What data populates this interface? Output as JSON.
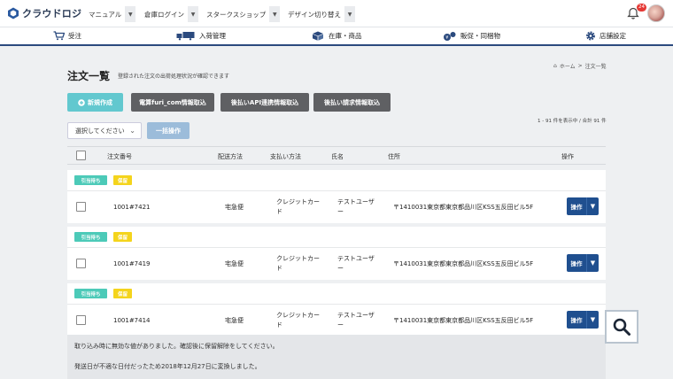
{
  "brand": {
    "name": "クラウドロジ"
  },
  "topmenu": [
    {
      "label": "マニュアル"
    },
    {
      "label": "倉庫ログイン"
    },
    {
      "label": "スタークスショップ"
    },
    {
      "label": "デザイン切り替え"
    }
  ],
  "notifications": {
    "count": "24"
  },
  "nav": [
    {
      "label": "受注",
      "icon": "cart-icon"
    },
    {
      "label": "入荷管理",
      "icon": "truck-icon"
    },
    {
      "label": "在庫・商品",
      "icon": "box-icon"
    },
    {
      "label": "販促・同梱物",
      "icon": "promo-icon"
    },
    {
      "label": "店舗設定",
      "icon": "gear-icon"
    }
  ],
  "page": {
    "title": "注文一覧",
    "subtitle": "登録された注文の出荷処理状況が確認できます",
    "breadcrumb": {
      "home": "ホーム",
      "separator": ">",
      "current": "注文一覧"
    }
  },
  "actions": {
    "new": "新規作成",
    "import1": "電算furi_com情報取込",
    "import2": "後払いAPI連携情報取込",
    "import3": "後払い請求情報取込"
  },
  "list": {
    "count_text": "1 - 91 件を表示中 / 合計 91 件",
    "select_placeholder": "選択してください",
    "bulk_label": "一括操作"
  },
  "table": {
    "headers": {
      "order_no": "注文番号",
      "shipping": "配送方法",
      "payment": "支払い方法",
      "name": "氏名",
      "address": "住所",
      "ops": "操作"
    },
    "rows": [
      {
        "tags": [
          "引当待ち",
          "保留"
        ],
        "order_no": "1001#7421",
        "shipping": "宅急便",
        "payment_l1": "クレジットカー",
        "payment_l2": "ド",
        "name_l1": "テストユーザ",
        "name_l2": "ー",
        "address": "〒1410031東京都東京都品川区KSS五反田ビル5F",
        "op_label": "操作"
      },
      {
        "tags": [
          "引当待ち",
          "保留"
        ],
        "order_no": "1001#7419",
        "shipping": "宅急便",
        "payment_l1": "クレジットカー",
        "payment_l2": "ド",
        "name_l1": "テストユーザ",
        "name_l2": "ー",
        "address": "〒1410031東京都東京都品川区KSS五反田ビル5F",
        "op_label": "操作"
      },
      {
        "tags": [
          "引当待ち",
          "保留"
        ],
        "order_no": "1001#7414",
        "shipping": "宅急便",
        "payment_l1": "クレジットカー",
        "payment_l2": "ド",
        "name_l1": "テストユーザ",
        "name_l2": "ー",
        "address": "〒1410031東京都東京都品川区KSS五反田ビル5F",
        "op_label": "操作"
      }
    ],
    "notes": [
      "取り込み時に無効な値がありました。確認後に保留解除をしてください。",
      "発送日が不適な日付だったため2018年12月27日に変換しました。"
    ]
  },
  "colors": {
    "nav_border": "#2b4a7e",
    "primary": "#1f4f8f",
    "teal": "#62c8cf",
    "tag_pending": "#4ccab8",
    "tag_hold": "#f4d41c",
    "badge": "#e53935"
  }
}
